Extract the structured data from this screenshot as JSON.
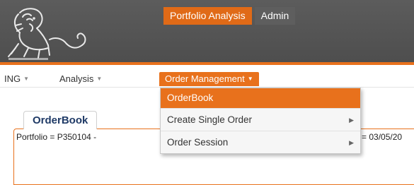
{
  "header": {
    "logo": "ing-lion-logo",
    "app_tabs": [
      {
        "label": "Portfolio Analysis",
        "active": true
      },
      {
        "label": "Admin",
        "active": false
      }
    ],
    "accent_color": "#e8711c",
    "header_color": "#545454"
  },
  "menubar": {
    "items": [
      {
        "label": "ING",
        "caret": "▼"
      },
      {
        "label": "Analysis",
        "caret": "▼"
      },
      {
        "label": "Order Management",
        "caret": "▼",
        "open": true
      }
    ]
  },
  "dropdown": {
    "items": [
      {
        "label": "OrderBook",
        "selected": true,
        "has_submenu": false
      },
      {
        "label": "Create Single Order",
        "selected": false,
        "has_submenu": true,
        "arrow": "▶"
      },
      {
        "label": "Order Session",
        "selected": false,
        "has_submenu": true,
        "arrow": "▶"
      }
    ]
  },
  "page": {
    "tab_label": "OrderBook",
    "info_left": "Portfolio = P350104 -",
    "info_right": "= 03/05/20"
  }
}
